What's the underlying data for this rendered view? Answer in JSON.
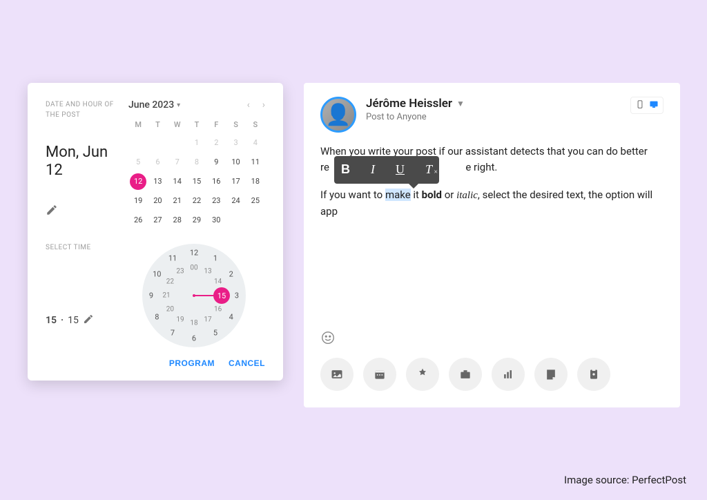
{
  "datepicker": {
    "sublabel": "DATE AND HOUR OF THE POST",
    "selected_date": "Mon, Jun\n12",
    "month_label": "June 2023",
    "weekday_heads": [
      "M",
      "T",
      "W",
      "T",
      "F",
      "S",
      "S"
    ],
    "leading_blanks": 3,
    "days_in_month": 30,
    "faded_through": 8,
    "selected_day": 12,
    "time_label": "SELECT TIME",
    "time_hour": "15",
    "time_min": "15",
    "outer_hours": [
      "12",
      "1",
      "2",
      "3",
      "4",
      "5",
      "6",
      "7",
      "8",
      "9",
      "10",
      "11"
    ],
    "inner_hours": [
      "00",
      "13",
      "14",
      "15",
      "16",
      "17",
      "18",
      "19",
      "20",
      "21",
      "22",
      "23"
    ],
    "program_btn": "Program",
    "cancel_btn": "Cancel",
    "selected_clock_value": "15"
  },
  "composer": {
    "author_name": "Jérôme Heissler",
    "author_sub": "Post to Anyone",
    "body_line1": "When you write your post if our assistant detects that you can do better",
    "body_line1b_prefix": "re",
    "body_line1b_suffix": "e right.",
    "line2_a": "If you want to ",
    "line2_make": "make",
    "line2_b": " it ",
    "line2_bold": "bold",
    "line2_c": " or ",
    "line2_italic": "italic",
    "line2_d": ", select the desired text, the option will app"
  },
  "tools": [
    "image",
    "calendar",
    "badge",
    "briefcase",
    "chart",
    "note",
    "clipboard"
  ],
  "credit": "Image source: PerfectPost"
}
